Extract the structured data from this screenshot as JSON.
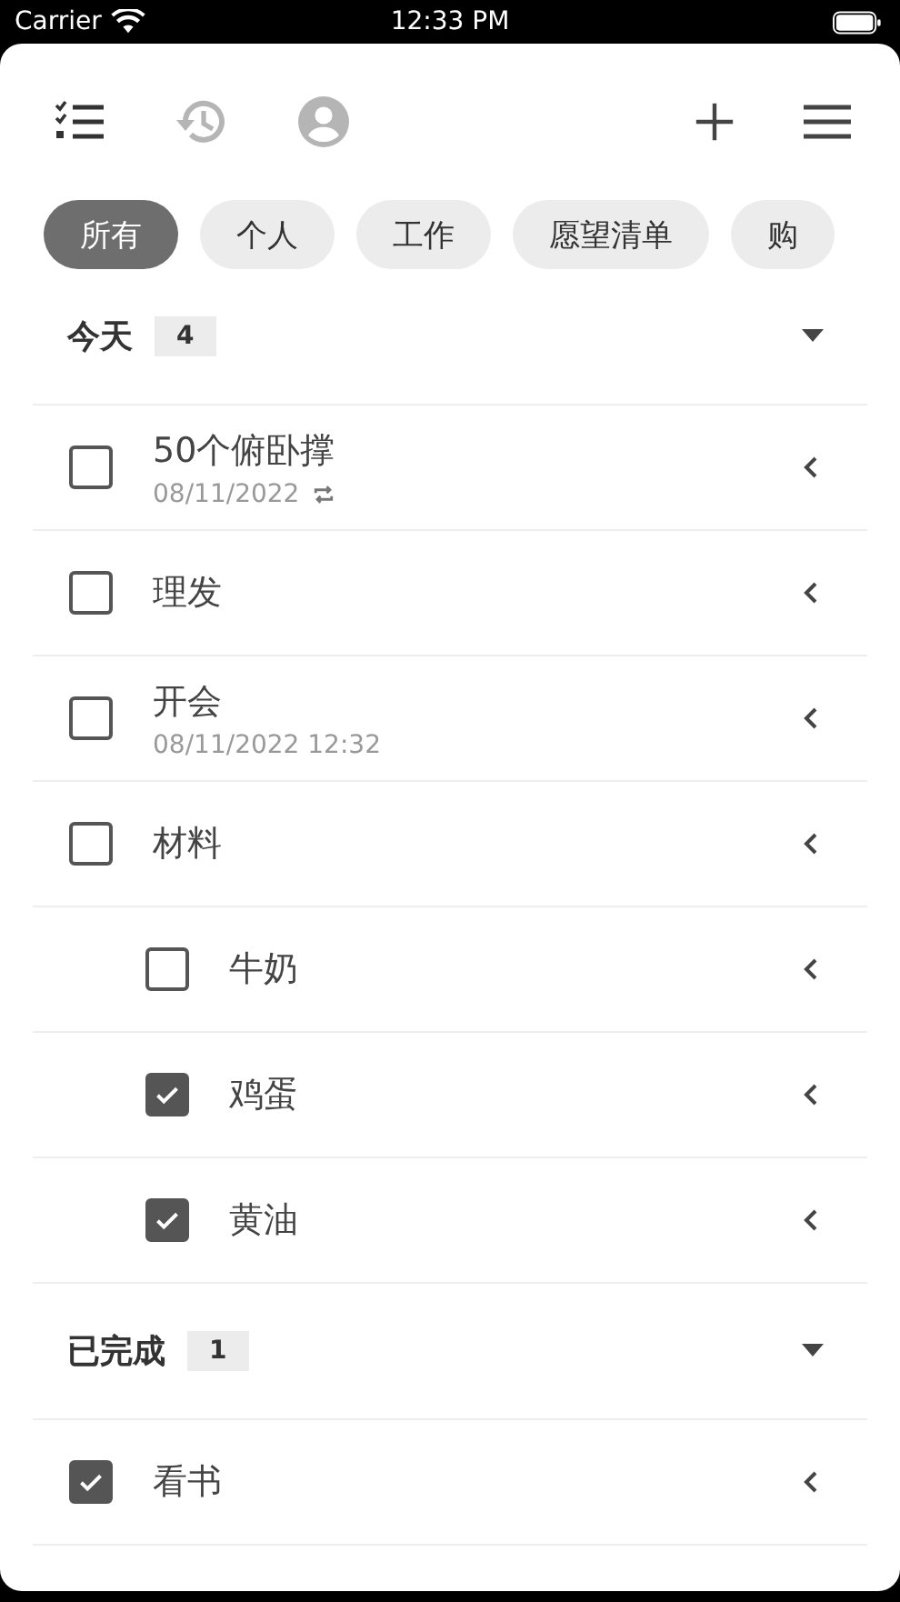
{
  "status_bar": {
    "carrier": "Carrier",
    "time": "12:33 PM"
  },
  "view_tabs": [
    {
      "kind": "checklist",
      "selected": true
    },
    {
      "kind": "history",
      "selected": false
    },
    {
      "kind": "profile",
      "selected": false
    }
  ],
  "categories": [
    {
      "label": "所有",
      "selected": true
    },
    {
      "label": "个人",
      "selected": false
    },
    {
      "label": "工作",
      "selected": false
    },
    {
      "label": "愿望清单",
      "selected": false
    },
    {
      "label": "购",
      "selected": false
    }
  ],
  "sections": [
    {
      "title": "今天",
      "count": "4",
      "expanded": true,
      "tasks": [
        {
          "title": "50个俯卧撑",
          "date": "08/11/2022",
          "repeat": true,
          "checked": false
        },
        {
          "title": "理发",
          "checked": false
        },
        {
          "title": "开会",
          "date": "08/11/2022 12:32",
          "checked": false
        },
        {
          "title": "材料",
          "checked": false,
          "children": [
            {
              "title": "牛奶",
              "checked": false
            },
            {
              "title": "鸡蛋",
              "checked": true
            },
            {
              "title": "黄油",
              "checked": true
            }
          ]
        }
      ]
    },
    {
      "title": "已完成",
      "count": "1",
      "expanded": true,
      "tasks": [
        {
          "title": "看书",
          "checked": true
        }
      ]
    }
  ]
}
